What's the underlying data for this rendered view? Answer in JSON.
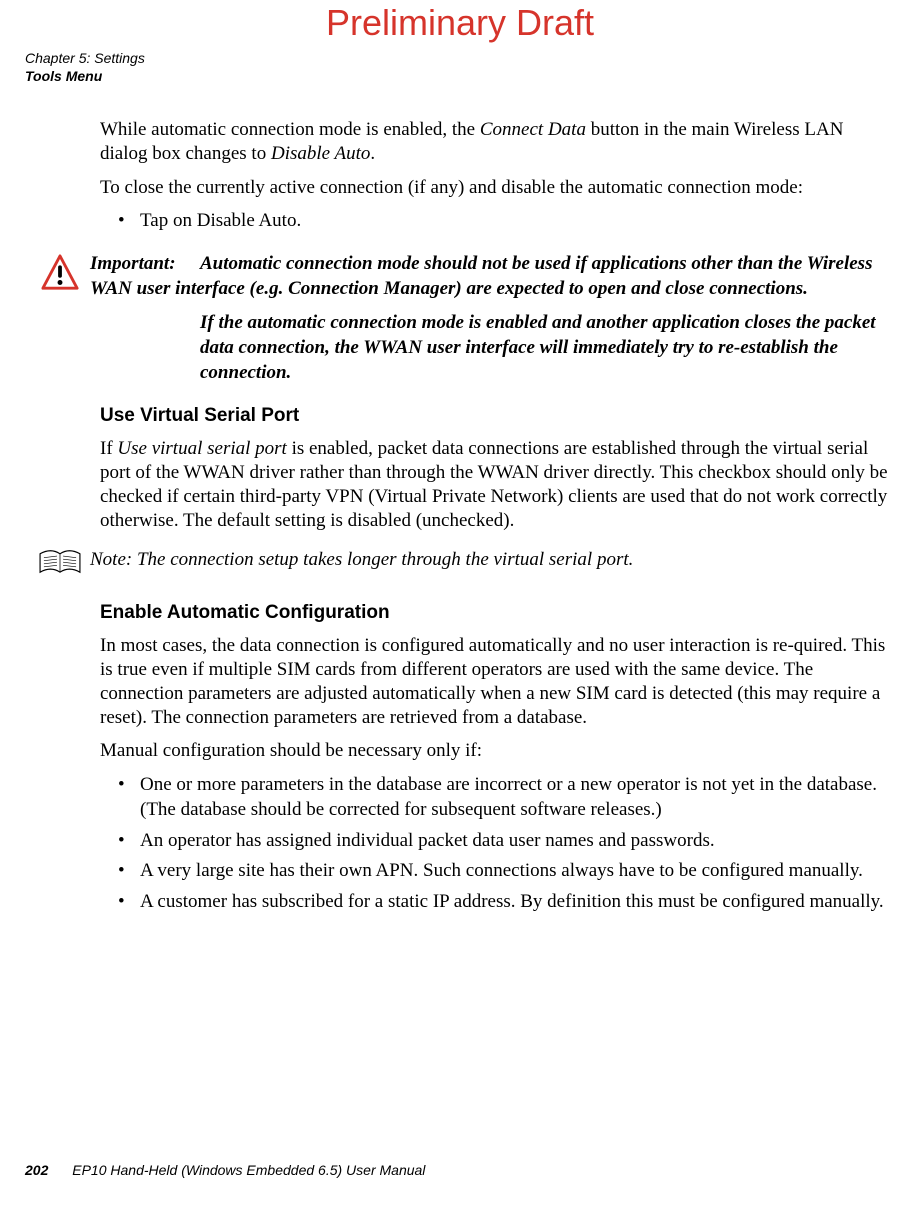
{
  "watermark": "Preliminary Draft",
  "header": {
    "line1": "Chapter 5: Settings",
    "line2": "Tools Menu"
  },
  "intro": {
    "p1_a": "While automatic connection mode is enabled, the ",
    "p1_b": "Connect Data",
    "p1_c": " button in the main Wireless LAN dialog box changes to ",
    "p1_d": "Disable Auto",
    "p1_e": ".",
    "p2": "To close the currently active connection (if any) and disable the automatic connection mode:",
    "bullet1_a": "Tap on ",
    "bullet1_b": "Disable Auto",
    "bullet1_c": "."
  },
  "important": {
    "label": "Important:  ",
    "p1": "Automatic connection mode should not be used if applications other than the Wireless WAN user interface (e.g. Connection Manager) are expected to open and close connections.",
    "p2": "If the automatic connection mode is enabled and another application closes the packet data connection, the WWAN user interface will immediately try to re-establish the connection."
  },
  "sectionA": {
    "heading": "Use Virtual Serial Port",
    "p1_a": "If ",
    "p1_b": "Use virtual serial port",
    "p1_c": " is enabled, packet data connections are established through the virtual serial port of the WWAN driver rather than through the WWAN driver directly. This checkbox should only be checked if certain third-party VPN (Virtual Private Network) clients are used that do not work correctly otherwise. The default setting is disabled (unchecked)."
  },
  "note": {
    "text": "Note: The connection setup takes longer through the virtual serial port."
  },
  "sectionB": {
    "heading": "Enable Automatic Configuration",
    "p1": "In most cases, the data connection is configured automatically and no user interaction is re-quired. This is true even if multiple SIM cards from different operators are used with the same device. The connection parameters are adjusted automatically when a new SIM card is detected (this may require a reset). The connection parameters are retrieved from a database.",
    "p2": "Manual configuration should be necessary only if:",
    "bullets": [
      "One or more parameters in the database are incorrect or a new operator is not yet in the database. (The database should be corrected for subsequent software releases.)",
      "An operator has assigned individual packet data user names and passwords.",
      "A very large site has their own APN. Such connections always have to be configured manually.",
      "A customer has subscribed for a static IP address. By definition this must be configured manually."
    ]
  },
  "footer": {
    "page": "202",
    "title": "EP10 Hand-Held (Windows Embedded 6.5) User Manual"
  }
}
